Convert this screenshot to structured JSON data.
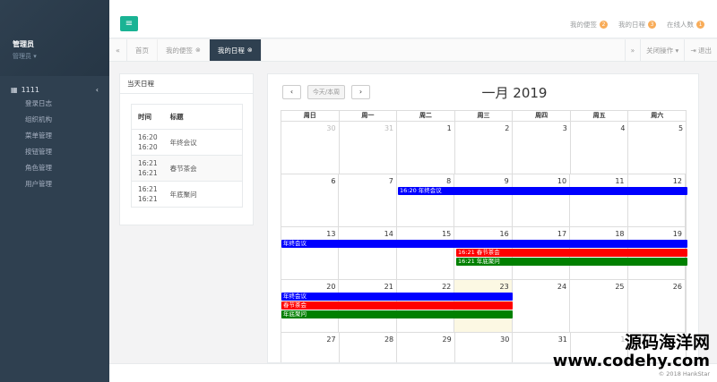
{
  "sidebar": {
    "user_name": "管理员",
    "user_role": "管理员 ▾",
    "group_label": "1111",
    "items": [
      {
        "label": "登录日志"
      },
      {
        "label": "组织机构"
      },
      {
        "label": "菜单管理"
      },
      {
        "label": "按钮管理"
      },
      {
        "label": "角色管理"
      },
      {
        "label": "用户管理"
      }
    ]
  },
  "topbar": {
    "links": [
      {
        "label": "我的便签",
        "badge": "2"
      },
      {
        "label": "我的日程",
        "badge": "3"
      },
      {
        "label": "在线人数",
        "badge": "1"
      }
    ]
  },
  "tabs": {
    "items": [
      {
        "label": "首页"
      },
      {
        "label": "我的便签"
      },
      {
        "label": "我的日程"
      }
    ],
    "close_ops": "关闭操作 ▾",
    "logout": "退出"
  },
  "today_panel": {
    "title": "当天日程",
    "col_time": "时间",
    "col_title": "标题",
    "rows": [
      {
        "time1": "16:20",
        "time2": "16:20",
        "title": "年终会议"
      },
      {
        "time1": "16:21",
        "time2": "16:21",
        "title": "春节茶会"
      },
      {
        "time1": "16:21",
        "time2": "16:21",
        "title": "年底聚问"
      }
    ]
  },
  "calendar": {
    "today_btn": "今天/本周",
    "title": "一月 2019",
    "weekdays": [
      "周日",
      "周一",
      "周二",
      "周三",
      "周四",
      "周五",
      "周六"
    ],
    "weeks": [
      [
        "30",
        "31",
        "1",
        "2",
        "3",
        "4",
        "5"
      ],
      [
        "6",
        "7",
        "8",
        "9",
        "10",
        "11",
        "12"
      ],
      [
        "13",
        "14",
        "15",
        "16",
        "17",
        "18",
        "19"
      ],
      [
        "20",
        "21",
        "22",
        "23",
        "24",
        "25",
        "26"
      ],
      [
        "27",
        "28",
        "29",
        "30",
        "31",
        "1",
        "2"
      ]
    ],
    "events": {
      "w2_meeting": "16:20 年终会议",
      "w3_meeting": "年终会议",
      "w3_tea": "16:21 春节茶会",
      "w3_gather": "16:21 年底聚问",
      "w4_meeting": "年终会议",
      "w4_tea": "春节茶会",
      "w4_gather": "年底聚问"
    },
    "colors": {
      "blue": "#0000ff",
      "red": "#ff0000",
      "green": "#008000"
    }
  },
  "footer": {
    "copyright": "© 2018 HankStar"
  },
  "watermark": {
    "line1": "源码海洋网",
    "line2": "www.codehy.com"
  }
}
